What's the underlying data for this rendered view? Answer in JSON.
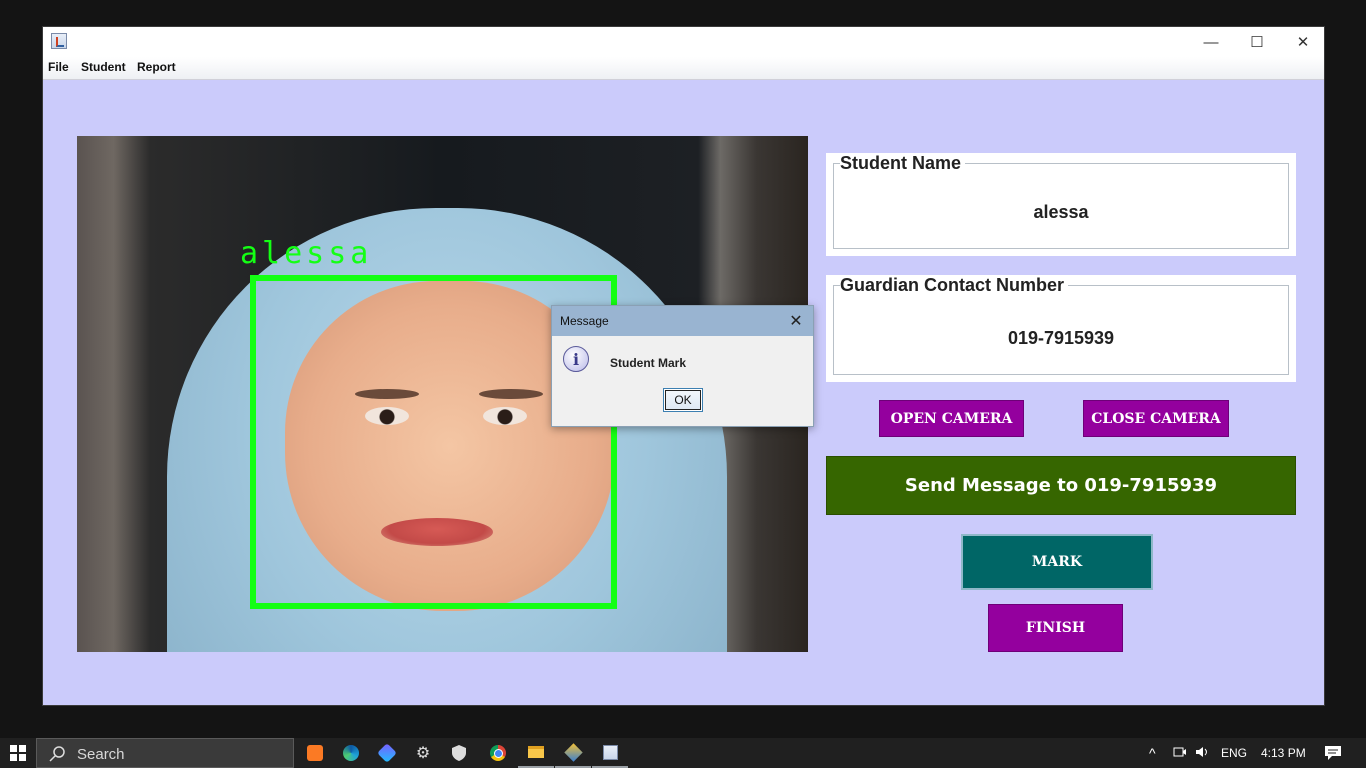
{
  "menu": [
    "File",
    "Student",
    "Report"
  ],
  "window_controls": {
    "minimize": "—",
    "maximize": "☐",
    "close": "✕"
  },
  "camera": {
    "face_label": "alessa"
  },
  "student_name": {
    "title": "Student Name",
    "value": "alessa"
  },
  "guardian_contact": {
    "title": "Guardian Contact Number",
    "value": "019-7915939"
  },
  "buttons": {
    "open_camera": "OPEN CAMERA",
    "close_camera": "CLOSE CAMERA",
    "send_message": "Send Message to 019-7915939",
    "mark": "MARK",
    "finish": "FINISH"
  },
  "colors": {
    "window_background": "#cbcbfb",
    "purple_button": "#94009e",
    "send_button": "#366600",
    "mark_button": "#006666",
    "face_box": "#14ff14"
  },
  "dialog": {
    "title": "Message",
    "close": "✕",
    "icon": "i",
    "message": "Student Mark",
    "ok_label": "OK"
  },
  "taskbar": {
    "search_placeholder": "Search",
    "language": "ENG",
    "time": "4:13 PM",
    "tray_chevron": "^",
    "apps": [
      "xampp-icon",
      "edge-icon",
      "copilot-icon",
      "settings-icon",
      "security-icon",
      "chrome-icon",
      "file-explorer-icon",
      "netbeans-icon",
      "java-app-icon"
    ]
  }
}
